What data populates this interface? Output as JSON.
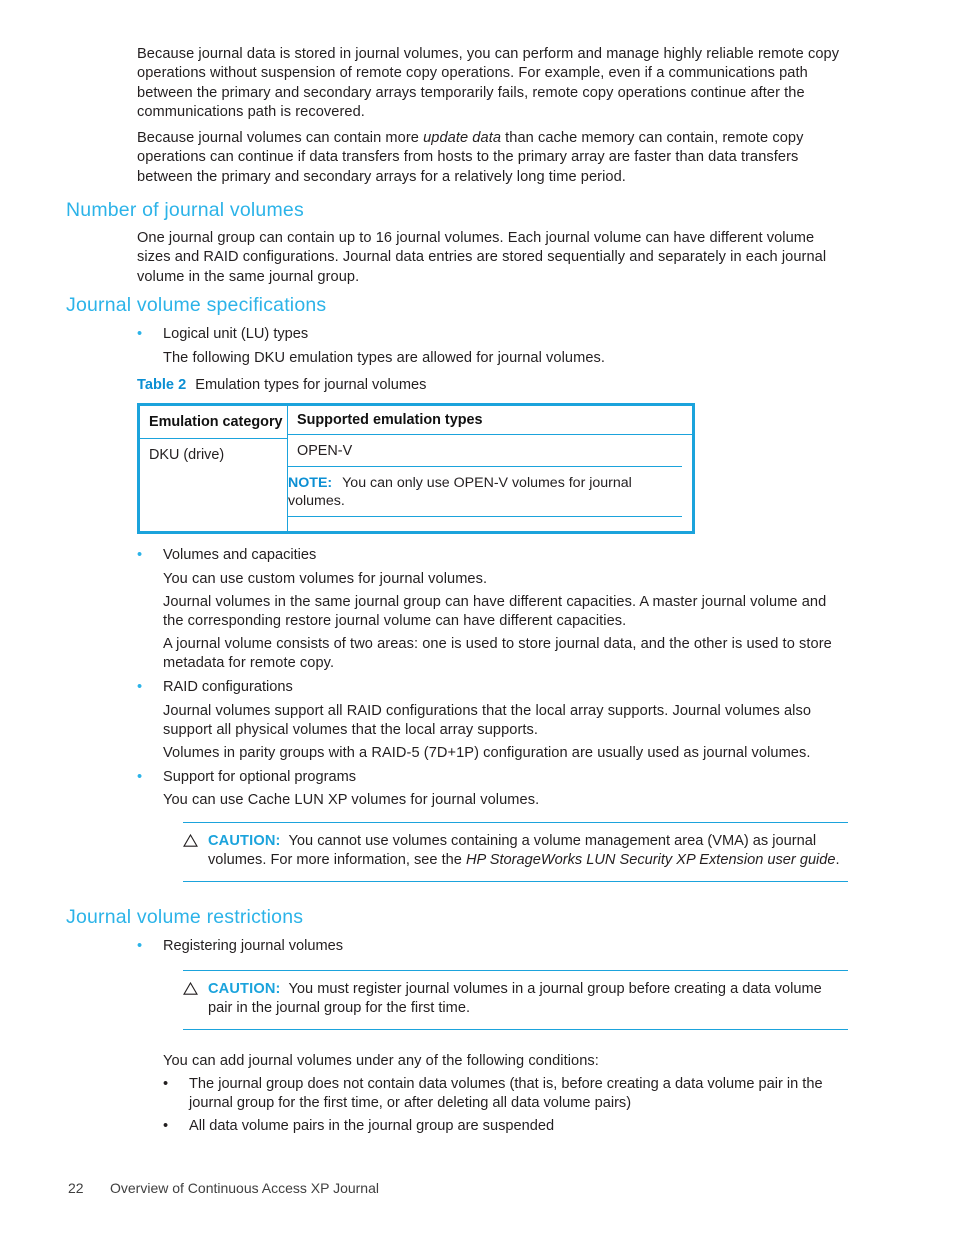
{
  "page": {
    "paragraphs": {
      "intro1": "Because journal data is stored in journal volumes, you can perform and manage highly reliable remote copy operations without suspension of remote copy operations. For example, even if a communications path between the primary and secondary arrays temporarily fails, remote copy operations continue after the communications path is recovered.",
      "intro2_a": "Because journal volumes can contain more ",
      "intro2_em": "update data",
      "intro2_b": " than cache memory can contain, remote copy operations can continue if data transfers from hosts to the primary array are faster than data transfers between the primary and secondary arrays for a relatively long time period.",
      "number_body": "One journal group can contain up to 16 journal volumes. Each journal volume can have different volume sizes and RAID configurations. Journal data entries are stored sequentially and separately in each journal volume in the same journal group.",
      "lu_detail": "The following DKU emulation types are allowed for journal volumes.",
      "vol_custom": "You can use custom volumes for journal volumes.",
      "vol_capacities": "Journal volumes in the same journal group can have different capacities. A master journal volume and the corresponding restore journal volume can have different capacities.",
      "vol_areas": "A journal volume consists of two areas: one is used to store journal data, and the other is used to store metadata for remote copy.",
      "raid_support": "Journal volumes support all RAID configurations that the local array supports. Journal volumes also support all physical volumes that the local array supports.",
      "raid_parity": "Volumes in parity groups with a RAID-5 (7D+1P) configuration are usually used as journal volumes.",
      "optional_detail": "You can use Cache LUN XP volumes for journal volumes.",
      "conditions_lead": "You can add journal volumes under any of the following conditions:"
    },
    "headings": {
      "number_of_journal_volumes": "Number of journal volumes",
      "journal_volume_specifications": "Journal volume specifications",
      "journal_volume_restrictions": "Journal volume restrictions"
    },
    "bullets": {
      "lu_types": "Logical unit (LU) types",
      "volumes_capacities": "Volumes and capacities",
      "raid_configurations": "RAID configurations",
      "optional_programs": "Support for optional programs",
      "registering": "Registering journal volumes",
      "cond1": "The journal group does not contain data volumes (that is, before creating a data volume pair in the journal group for the first time, or after deleting all data volume pairs)",
      "cond2": "All data volume pairs in the journal group are suspended"
    },
    "table": {
      "caption_number": "Table 2",
      "caption_text": "Emulation types for journal volumes",
      "headers": [
        "Emulation category",
        "Supported emulation types"
      ],
      "rows": [
        {
          "category": "DKU (drive)",
          "type": "OPEN-V",
          "note_label": "NOTE:",
          "note_text": "You can only use OPEN-V volumes for journal volumes."
        }
      ]
    },
    "cautions": [
      {
        "label": "CAUTION:",
        "text_a": "You cannot use volumes containing a volume management area (VMA) as journal volumes. For more information, see the ",
        "text_em": "HP StorageWorks LUN Security XP Extension user guide",
        "text_b": "."
      },
      {
        "label": "CAUTION:",
        "text_a": "You must register journal volumes in a journal group before creating a data volume pair in the journal group for the first time.",
        "text_em": "",
        "text_b": ""
      }
    ],
    "footer": {
      "page_number": "22",
      "chapter_title": "Overview of Continuous Access XP Journal"
    },
    "colors": {
      "heading_cyan": "#2cb3e8",
      "accent_blue": "#0b8fd3",
      "table_border": "#1ba3dc",
      "body_text": "#231f20"
    }
  }
}
